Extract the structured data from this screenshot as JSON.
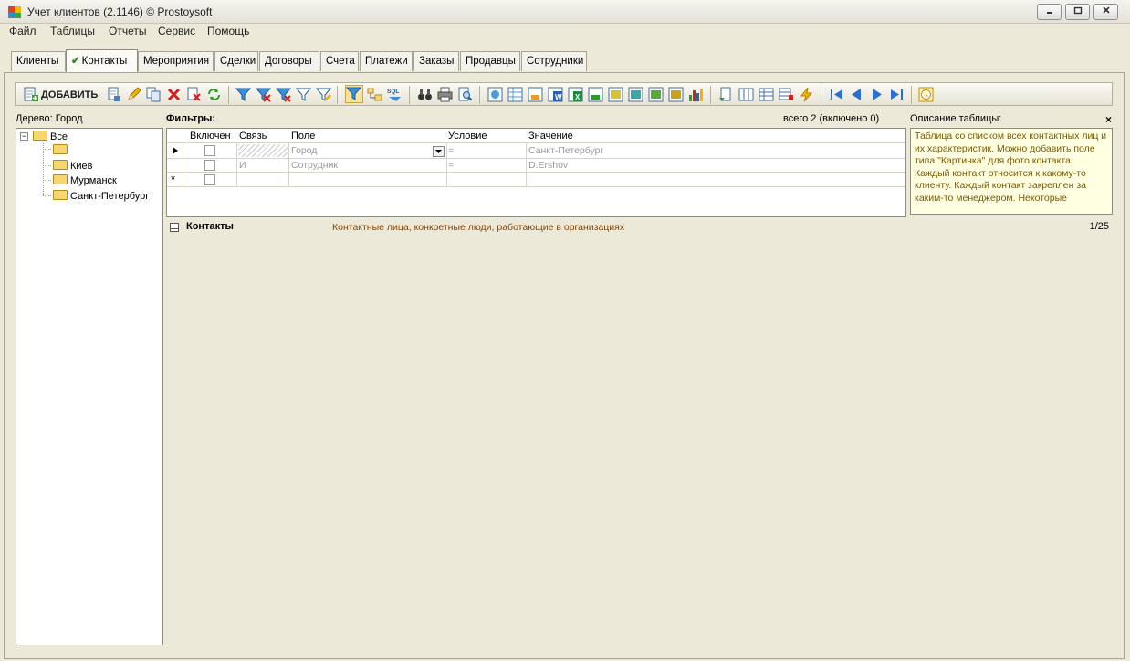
{
  "window": {
    "title": "Учет клиентов (2.1146) © Prostoysoft",
    "minimize": "0",
    "restore": "1",
    "close": "r"
  },
  "menu": [
    "Файл",
    "Таблицы",
    "Отчеты",
    "Сервис",
    "Помощь"
  ],
  "tabs": [
    "Клиенты",
    "Контакты",
    "Мероприятия",
    "Сделки",
    "Договоры",
    "Счета",
    "Платежи",
    "Заказы",
    "Продавцы",
    "Сотрудники"
  ],
  "active_tab": "Контакты",
  "toolbar": {
    "add_label": "ДОБАВИТЬ"
  },
  "tree": {
    "label": "Дерево: Город",
    "items": [
      "Все",
      "",
      "Киев",
      "Мурманск",
      "Санкт-Петербург"
    ]
  },
  "filters": {
    "title": "Фильтры:",
    "count": "всего 2 (включено 0)",
    "headers": [
      "Включен",
      "Связь",
      "Поле",
      "Условие",
      "Значение"
    ],
    "rows": [
      {
        "link": "",
        "field": "Город",
        "cond": "=",
        "value": "Санкт-Петербург"
      },
      {
        "link": "И",
        "field": "Сотрудник",
        "cond": "=",
        "value": "D.Ershov"
      }
    ]
  },
  "description": {
    "title": "Описание таблицы:",
    "close": "×",
    "text": "Таблица со списком всех контактных лиц и их характеристик. Можно добавить поле типа \"Картинка\" для фото контакта. Каждый контакт относится к какому-то клиенту. Каждый контакт закреплен за каким-то менеджером. Некоторые"
  },
  "contacts": {
    "title": "Контакты",
    "subtitle": "Контактные лица, конкретные люди, работающие в организациях",
    "page": "1/25"
  }
}
